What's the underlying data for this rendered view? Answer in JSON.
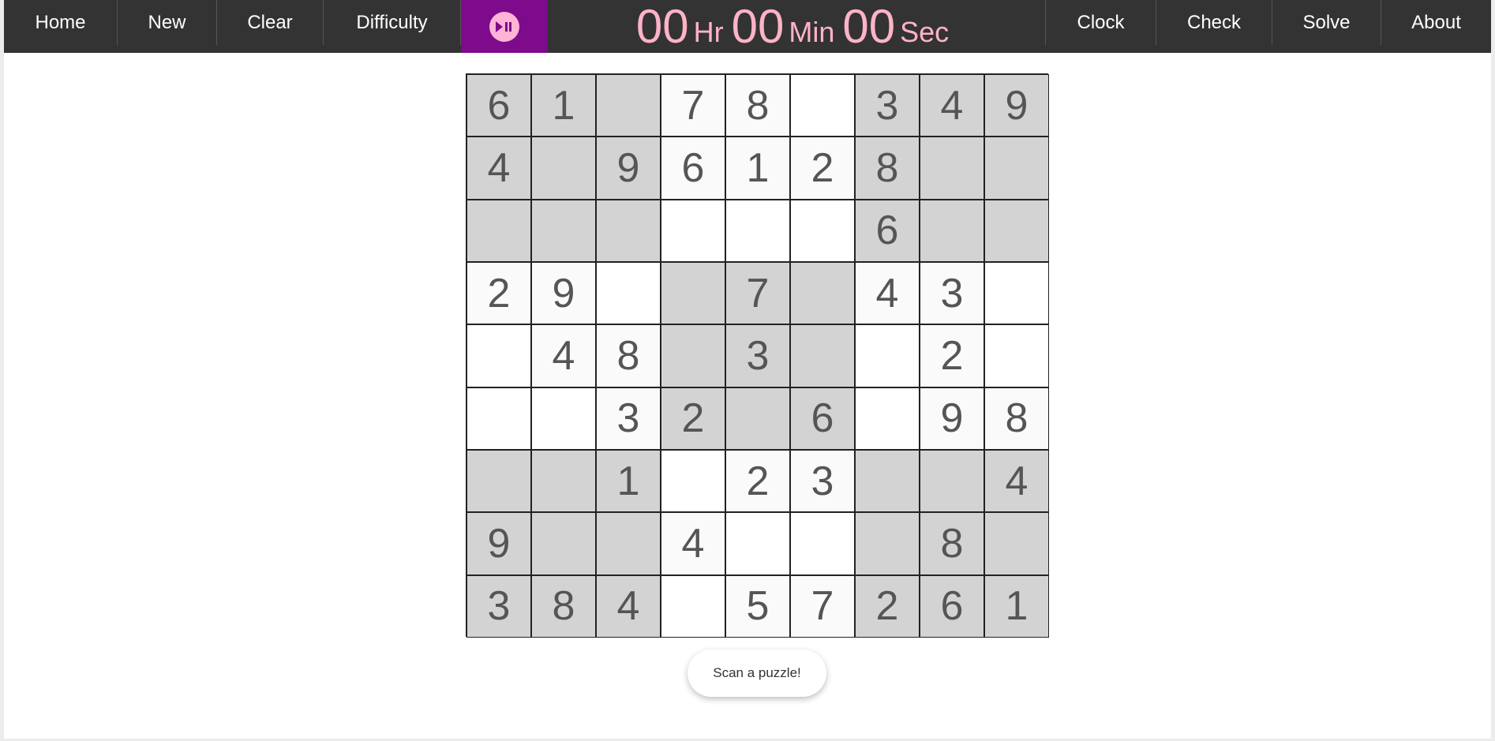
{
  "nav": {
    "home": "Home",
    "new": "New",
    "clear": "Clear",
    "difficulty": "Difficulty",
    "clock": "Clock",
    "check": "Check",
    "solve": "Solve",
    "about": "About"
  },
  "timer": {
    "hours": "00",
    "hr_label": "Hr",
    "minutes": "00",
    "min_label": "Min",
    "seconds": "00",
    "sec_label": "Sec"
  },
  "board": [
    [
      "6",
      "1",
      "",
      "7",
      "8",
      "",
      "3",
      "4",
      "9"
    ],
    [
      "4",
      "",
      "9",
      "6",
      "1",
      "2",
      "8",
      "",
      ""
    ],
    [
      "",
      "",
      "",
      "",
      "",
      "",
      "6",
      "",
      ""
    ],
    [
      "2",
      "9",
      "",
      "",
      "7",
      "",
      "4",
      "3",
      ""
    ],
    [
      "",
      "4",
      "8",
      "",
      "3",
      "",
      "",
      "2",
      ""
    ],
    [
      "",
      "",
      "3",
      "2",
      "",
      "6",
      "",
      "9",
      "8"
    ],
    [
      "",
      "",
      "1",
      "",
      "2",
      "3",
      "",
      "",
      "4"
    ],
    [
      "9",
      "",
      "",
      "4",
      "",
      "",
      "",
      "8",
      ""
    ],
    [
      "3",
      "8",
      "4",
      "",
      "5",
      "7",
      "2",
      "6",
      "1"
    ]
  ],
  "scan_button": "Scan a puzzle!",
  "colors": {
    "navbar": "#333333",
    "play_button": "#7e0a8c",
    "timer_text": "#ffb3c7",
    "shaded_box": "#d3d3d3"
  }
}
